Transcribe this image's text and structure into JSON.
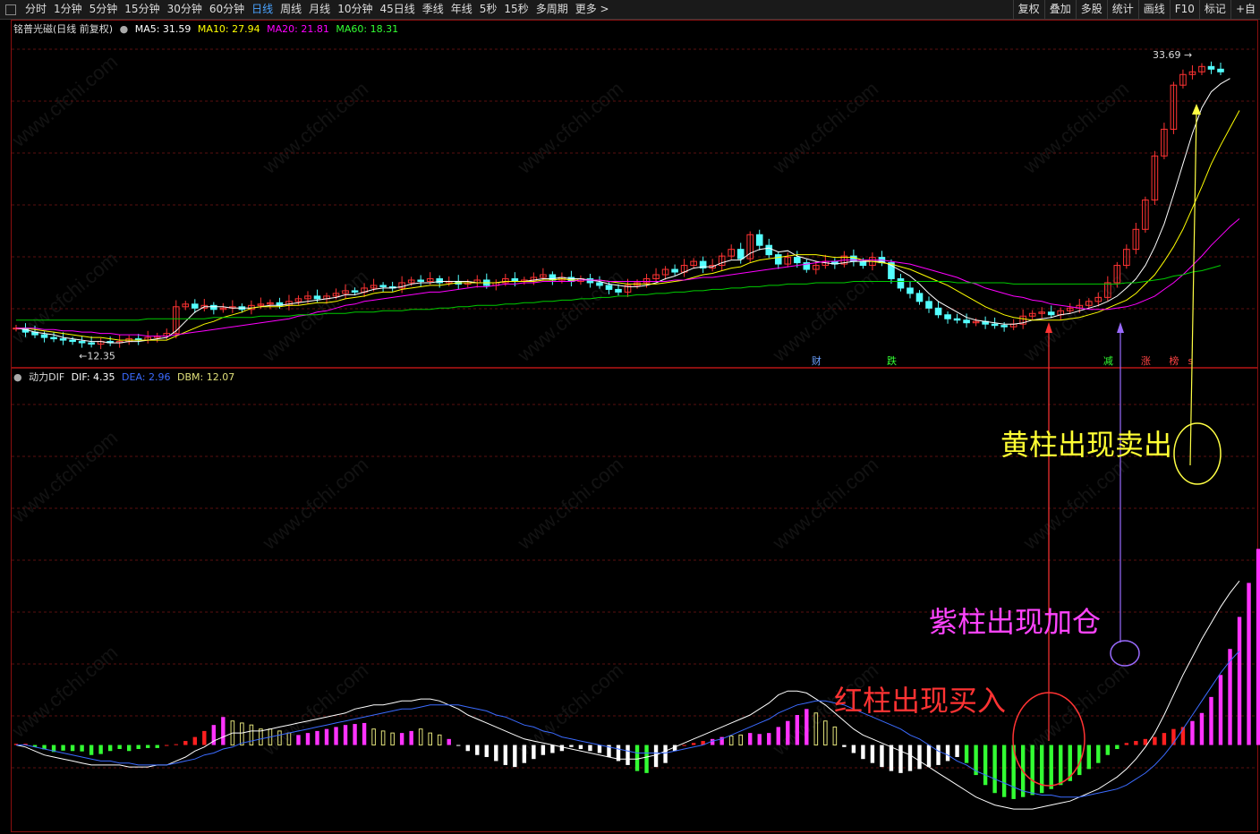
{
  "toolbar": {
    "periods": [
      "分时",
      "1分钟",
      "5分钟",
      "15分钟",
      "30分钟",
      "60分钟",
      "日线",
      "周线",
      "月线",
      "10分钟",
      "45日线",
      "季线",
      "年线",
      "5秒",
      "15秒",
      "多周期",
      "更多 >"
    ],
    "active_period": "日线",
    "tools": [
      "复权",
      "叠加",
      "多股",
      "统计",
      "画线",
      "F10",
      "标记",
      "+自"
    ]
  },
  "watermark": "www.cfchi.com",
  "colors": {
    "ma5": "#ffffff",
    "ma10": "#ffff00",
    "ma20": "#ff00ff",
    "ma60": "#00cc00",
    "up": "#ff3333",
    "down": "#54ffff",
    "dea": "#3b6bff",
    "bar_red": "#ff2020",
    "bar_magenta": "#ff33ff",
    "bar_yellow": "#e0e07a",
    "bar_green": "#33ff33",
    "bar_white": "#ffffff"
  },
  "chart_data": [
    {
      "type": "candlestick",
      "title": "铭普光磁(日线 前复权)",
      "legend": [
        {
          "label": "MA5: 31.59",
          "color": "#ffffff"
        },
        {
          "label": "MA10: 27.94",
          "color": "#ffff00"
        },
        {
          "label": "MA20: 21.81",
          "color": "#ff00ff"
        },
        {
          "label": "MA60: 18.31",
          "color": "#00cc00"
        }
      ],
      "ylim": [
        11.5,
        35.5
      ],
      "annotations": {
        "high": "33.69",
        "low": "12.35"
      },
      "signals": [
        {
          "text": "财",
          "index": 85,
          "color": "#6aa0ff"
        },
        {
          "text": "跌",
          "index": 93,
          "color": "#33ff33"
        },
        {
          "text": "减",
          "index": 116,
          "color": "#33ff33"
        },
        {
          "text": "涨",
          "index": 120,
          "color": "#ff4444"
        },
        {
          "text": "榜",
          "index": 123,
          "color": "#ff4444"
        },
        {
          "text": "s",
          "index": 125,
          "color": "#ff4444"
        }
      ],
      "closes": [
        13.6,
        13.3,
        13.1,
        12.9,
        12.8,
        12.7,
        12.6,
        12.5,
        12.4,
        12.6,
        12.5,
        12.6,
        12.8,
        12.7,
        12.9,
        13.0,
        13.2,
        15.2,
        15.4,
        15.1,
        15.3,
        15.0,
        15.1,
        15.2,
        15.0,
        15.3,
        15.4,
        15.5,
        15.3,
        15.6,
        15.8,
        16.0,
        15.8,
        16.0,
        16.2,
        16.4,
        16.3,
        16.6,
        16.8,
        16.7,
        16.6,
        17.0,
        17.2,
        17.1,
        17.3,
        17.0,
        17.1,
        16.9,
        17.0,
        17.2,
        16.8,
        17.0,
        17.3,
        17.1,
        17.2,
        17.4,
        17.6,
        17.2,
        17.4,
        17.1,
        17.3,
        17.0,
        16.8,
        16.5,
        16.3,
        16.8,
        17.0,
        17.3,
        17.6,
        18.0,
        17.8,
        18.3,
        18.6,
        18.1,
        18.3,
        19.0,
        19.5,
        18.8,
        20.6,
        19.8,
        19.1,
        18.4,
        18.9,
        18.5,
        18.0,
        18.3,
        18.6,
        18.4,
        19.0,
        18.6,
        18.3,
        18.9,
        18.5,
        17.3,
        16.6,
        16.2,
        15.6,
        15.1,
        14.6,
        14.3,
        14.2,
        14.0,
        14.1,
        13.9,
        13.8,
        13.7,
        13.9,
        14.5,
        14.7,
        14.8,
        14.6,
        14.9,
        15.1,
        15.3,
        15.6,
        15.9,
        17.0,
        18.3,
        19.5,
        21.0,
        23.2,
        26.5,
        28.5,
        31.8,
        32.6,
        32.8,
        33.2,
        33.0,
        32.8
      ],
      "ma_series": {
        "MA5": [
          13.6,
          13.5,
          13.3,
          13.2,
          13.1,
          12.9,
          12.8,
          12.7,
          12.6,
          12.6,
          12.5,
          12.5,
          12.6,
          12.6,
          12.7,
          12.8,
          12.9,
          13.4,
          14.1,
          14.8,
          15.2,
          15.2,
          15.2,
          15.1,
          15.1,
          15.1,
          15.2,
          15.3,
          15.3,
          15.4,
          15.5,
          15.6,
          15.7,
          15.8,
          15.9,
          16.1,
          16.1,
          16.3,
          16.5,
          16.6,
          16.6,
          16.7,
          16.9,
          17.0,
          17.0,
          17.1,
          17.1,
          17.1,
          17.1,
          17.0,
          17.0,
          17.0,
          17.1,
          17.1,
          17.1,
          17.2,
          17.3,
          17.3,
          17.4,
          17.3,
          17.3,
          17.2,
          17.1,
          16.9,
          16.8,
          16.7,
          16.7,
          16.8,
          17.0,
          17.3,
          17.5,
          17.8,
          18.1,
          18.2,
          18.2,
          18.5,
          18.7,
          18.7,
          19.2,
          19.5,
          19.6,
          19.3,
          19.4,
          19.0,
          18.8,
          18.6,
          18.5,
          18.4,
          18.5,
          18.6,
          18.6,
          18.6,
          18.6,
          18.3,
          17.9,
          17.5,
          16.9,
          16.2,
          15.6,
          15.2,
          14.8,
          14.4,
          14.2,
          14.1,
          14.0,
          13.9,
          13.9,
          14.0,
          14.2,
          14.3,
          14.4,
          14.6,
          14.7,
          14.9,
          15.1,
          15.3,
          15.6,
          16.0,
          16.6,
          17.3,
          18.3,
          19.7,
          21.4,
          23.6,
          25.9,
          28.2,
          30.1,
          31.3,
          31.9,
          32.3
        ],
        "MA10": [
          13.6,
          13.6,
          13.5,
          13.4,
          13.3,
          13.2,
          13.1,
          13.0,
          12.9,
          12.9,
          12.8,
          12.7,
          12.7,
          12.7,
          12.7,
          12.7,
          12.7,
          13.0,
          13.3,
          13.6,
          13.9,
          14.1,
          14.4,
          14.6,
          14.8,
          15.1,
          15.2,
          15.2,
          15.2,
          15.3,
          15.3,
          15.4,
          15.5,
          15.5,
          15.6,
          15.8,
          15.9,
          16.0,
          16.2,
          16.3,
          16.3,
          16.5,
          16.6,
          16.7,
          16.8,
          16.8,
          16.9,
          17.0,
          17.0,
          17.0,
          17.0,
          17.0,
          17.1,
          17.1,
          17.1,
          17.1,
          17.2,
          17.2,
          17.3,
          17.2,
          17.2,
          17.2,
          17.2,
          17.1,
          17.0,
          16.9,
          16.9,
          16.9,
          16.9,
          17.0,
          17.1,
          17.2,
          17.4,
          17.6,
          17.7,
          17.9,
          18.1,
          18.2,
          18.5,
          18.7,
          18.8,
          18.9,
          19.0,
          19.1,
          19.1,
          19.1,
          19.0,
          18.9,
          18.9,
          18.9,
          18.7,
          18.6,
          18.5,
          18.4,
          18.2,
          18.0,
          17.7,
          17.4,
          17.1,
          16.8,
          16.4,
          16.0,
          15.6,
          15.2,
          14.9,
          14.6,
          14.4,
          14.3,
          14.2,
          14.2,
          14.2,
          14.2,
          14.3,
          14.4,
          14.6,
          14.8,
          15.1,
          15.4,
          15.7,
          16.2,
          16.9,
          17.6,
          18.6,
          19.7,
          21.0,
          22.6,
          24.2,
          25.9,
          27.3,
          28.6,
          29.9
        ],
        "MA20": [
          13.6,
          13.6,
          13.6,
          13.5,
          13.5,
          13.4,
          13.4,
          13.3,
          13.3,
          13.2,
          13.2,
          13.1,
          13.1,
          13.1,
          13.0,
          13.0,
          13.0,
          13.1,
          13.2,
          13.3,
          13.4,
          13.5,
          13.6,
          13.7,
          13.8,
          13.9,
          14.0,
          14.1,
          14.2,
          14.3,
          14.5,
          14.6,
          14.8,
          14.9,
          15.1,
          15.3,
          15.4,
          15.6,
          15.7,
          15.8,
          15.9,
          16.0,
          16.1,
          16.2,
          16.3,
          16.3,
          16.4,
          16.5,
          16.6,
          16.7,
          16.7,
          16.8,
          16.9,
          16.9,
          17.0,
          17.0,
          17.1,
          17.1,
          17.1,
          17.1,
          17.2,
          17.2,
          17.2,
          17.1,
          17.1,
          17.1,
          17.1,
          17.1,
          17.1,
          17.1,
          17.2,
          17.2,
          17.3,
          17.4,
          17.4,
          17.5,
          17.6,
          17.7,
          17.8,
          17.9,
          18.0,
          18.1,
          18.2,
          18.3,
          18.4,
          18.5,
          18.6,
          18.6,
          18.7,
          18.7,
          18.7,
          18.7,
          18.7,
          18.6,
          18.5,
          18.4,
          18.2,
          18.0,
          17.8,
          17.6,
          17.4,
          17.1,
          16.9,
          16.6,
          16.4,
          16.2,
          16.0,
          15.9,
          15.7,
          15.6,
          15.4,
          15.3,
          15.2,
          15.1,
          15.0,
          15.0,
          15.0,
          15.1,
          15.2,
          15.4,
          15.7,
          16.0,
          16.5,
          17.0,
          17.6,
          18.3,
          19.0,
          19.8,
          20.5,
          21.2,
          21.8
        ],
        "MA60": [
          14.2,
          14.2,
          14.2,
          14.2,
          14.2,
          14.2,
          14.2,
          14.2,
          14.2,
          14.2,
          14.2,
          14.2,
          14.2,
          14.2,
          14.3,
          14.3,
          14.3,
          14.3,
          14.3,
          14.3,
          14.3,
          14.4,
          14.4,
          14.4,
          14.4,
          14.4,
          14.5,
          14.5,
          14.5,
          14.5,
          14.6,
          14.6,
          14.6,
          14.7,
          14.7,
          14.7,
          14.8,
          14.8,
          14.8,
          14.9,
          14.9,
          14.9,
          15.0,
          15.0,
          15.0,
          15.1,
          15.1,
          15.2,
          15.2,
          15.3,
          15.3,
          15.3,
          15.4,
          15.4,
          15.5,
          15.5,
          15.6,
          15.6,
          15.7,
          15.7,
          15.8,
          15.8,
          15.9,
          15.9,
          16.0,
          16.0,
          16.1,
          16.1,
          16.2,
          16.2,
          16.3,
          16.3,
          16.4,
          16.4,
          16.5,
          16.5,
          16.6,
          16.6,
          16.7,
          16.7,
          16.8,
          16.8,
          16.9,
          16.9,
          16.9,
          17.0,
          17.0,
          17.0,
          17.0,
          17.1,
          17.1,
          17.1,
          17.1,
          17.1,
          17.1,
          17.1,
          17.1,
          17.1,
          17.1,
          17.1,
          17.0,
          17.0,
          17.0,
          17.0,
          17.0,
          17.0,
          16.9,
          16.9,
          16.9,
          16.9,
          16.9,
          16.9,
          16.9,
          16.9,
          16.9,
          16.9,
          16.9,
          16.9,
          17.0,
          17.0,
          17.1,
          17.2,
          17.3,
          17.5,
          17.6,
          17.8,
          17.9,
          18.1,
          18.3
        ]
      }
    },
    {
      "type": "histogram",
      "title": "动力DIF",
      "legend": [
        {
          "label": "DIF: 4.35",
          "color": "#ffffff"
        },
        {
          "label": "DEA: 2.96",
          "color": "#3b6bff"
        },
        {
          "label": "DBM: 12.07",
          "color": "#e0e07a"
        }
      ],
      "ylim": [
        -4,
        18
      ],
      "bars": [
        0.06,
        0.06,
        -0.1,
        -0.22,
        -0.35,
        -0.28,
        -0.3,
        -0.32,
        -0.5,
        -0.45,
        -0.3,
        -0.2,
        -0.3,
        -0.2,
        -0.15,
        -0.15,
        0.0,
        0.04,
        0.2,
        0.4,
        0.7,
        1.0,
        1.4,
        1.2,
        1.1,
        1.0,
        0.8,
        0.8,
        0.7,
        0.6,
        0.5,
        0.6,
        0.7,
        0.8,
        0.9,
        1.0,
        1.05,
        1.1,
        0.8,
        0.7,
        0.6,
        0.6,
        0.7,
        0.8,
        0.6,
        0.5,
        0.3,
        0.0,
        -0.3,
        -0.5,
        -0.6,
        -0.8,
        -1.0,
        -1.1,
        -0.9,
        -0.7,
        -0.5,
        -0.4,
        -0.3,
        -0.1,
        -0.2,
        -0.3,
        -0.4,
        -0.6,
        -0.8,
        -1.0,
        -1.3,
        -1.4,
        -1.1,
        -0.9,
        -0.3,
        0.0,
        0.1,
        0.2,
        0.3,
        0.4,
        0.45,
        0.5,
        0.6,
        0.55,
        0.6,
        0.9,
        1.2,
        1.5,
        1.8,
        1.6,
        1.2,
        0.9,
        -0.1,
        -0.4,
        -0.7,
        -0.9,
        -1.1,
        -1.3,
        -1.4,
        -1.3,
        -1.2,
        -1.1,
        -1.0,
        -0.8,
        -0.6,
        -0.9,
        -1.5,
        -2.0,
        -2.4,
        -2.6,
        -2.7,
        -2.6,
        -2.5,
        -2.4,
        -2.2,
        -2.0,
        -1.8,
        -1.5,
        -1.2,
        -0.9,
        -0.5,
        -0.2,
        0.1,
        0.2,
        0.3,
        0.4,
        0.6,
        0.8,
        0.9,
        1.2,
        1.6,
        2.4,
        3.5,
        4.8,
        6.4,
        8.1,
        9.8,
        11.2,
        12.07
      ],
      "bar_colors": [
        "r",
        "r",
        "g",
        "g",
        "g",
        "g",
        "g",
        "g",
        "g",
        "g",
        "g",
        "g",
        "g",
        "g",
        "g",
        "g",
        "r",
        "r",
        "r",
        "r",
        "r",
        "m",
        "m",
        "y",
        "y",
        "y",
        "y",
        "y",
        "y",
        "y",
        "m",
        "m",
        "m",
        "m",
        "m",
        "m",
        "m",
        "m",
        "y",
        "y",
        "y",
        "m",
        "m",
        "y",
        "y",
        "y",
        "m",
        "w",
        "w",
        "w",
        "w",
        "w",
        "w",
        "w",
        "w",
        "w",
        "w",
        "w",
        "w",
        "w",
        "w",
        "w",
        "w",
        "w",
        "w",
        "w",
        "g",
        "g",
        "w",
        "w",
        "w",
        "r",
        "r",
        "r",
        "m",
        "m",
        "y",
        "y",
        "m",
        "m",
        "m",
        "m",
        "m",
        "m",
        "m",
        "y",
        "y",
        "y",
        "w",
        "w",
        "w",
        "w",
        "w",
        "w",
        "w",
        "w",
        "w",
        "w",
        "w",
        "w",
        "w",
        "g",
        "g",
        "g",
        "g",
        "g",
        "g",
        "g",
        "g",
        "g",
        "g",
        "g",
        "g",
        "g",
        "g",
        "g",
        "g",
        "g",
        "r",
        "r",
        "r",
        "r",
        "r",
        "r",
        "r",
        "m",
        "m",
        "m",
        "m",
        "m",
        "m",
        "m",
        "m",
        "y",
        "y",
        "y"
      ],
      "dif": [
        0.0,
        -0.1,
        -0.3,
        -0.5,
        -0.6,
        -0.7,
        -0.8,
        -0.9,
        -1.0,
        -1.0,
        -1.0,
        -1.0,
        -1.1,
        -1.1,
        -1.1,
        -1.0,
        -1.0,
        -0.8,
        -0.6,
        -0.3,
        -0.1,
        0.2,
        0.4,
        0.6,
        0.6,
        0.7,
        0.7,
        0.8,
        0.9,
        1.0,
        1.1,
        1.2,
        1.3,
        1.4,
        1.5,
        1.6,
        1.8,
        1.9,
        2.0,
        2.0,
        2.1,
        2.2,
        2.2,
        2.3,
        2.3,
        2.2,
        2.0,
        1.8,
        1.5,
        1.3,
        1.1,
        0.9,
        0.7,
        0.5,
        0.3,
        0.2,
        0.1,
        0.0,
        -0.1,
        -0.2,
        -0.3,
        -0.4,
        -0.5,
        -0.6,
        -0.7,
        -0.7,
        -0.7,
        -0.6,
        -0.5,
        -0.3,
        -0.1,
        0.1,
        0.3,
        0.5,
        0.7,
        0.9,
        1.1,
        1.3,
        1.5,
        1.8,
        2.1,
        2.5,
        2.7,
        2.7,
        2.6,
        2.3,
        2.0,
        1.6,
        1.2,
        0.8,
        0.5,
        0.3,
        0.1,
        -0.1,
        -0.3,
        -0.5,
        -0.8,
        -1.1,
        -1.4,
        -1.7,
        -2.0,
        -2.3,
        -2.6,
        -2.8,
        -3.0,
        -3.1,
        -3.2,
        -3.2,
        -3.2,
        -3.1,
        -3.0,
        -2.9,
        -2.8,
        -2.6,
        -2.4,
        -2.2,
        -1.9,
        -1.6,
        -1.2,
        -0.7,
        -0.1,
        0.6,
        1.5,
        2.5,
        3.5,
        4.4,
        5.3,
        6.1,
        6.9,
        7.6,
        8.2
      ],
      "dea": [
        0.0,
        0.0,
        -0.1,
        -0.2,
        -0.3,
        -0.4,
        -0.5,
        -0.6,
        -0.7,
        -0.8,
        -0.8,
        -0.9,
        -0.9,
        -1.0,
        -1.0,
        -1.0,
        -1.0,
        -0.9,
        -0.8,
        -0.7,
        -0.5,
        -0.4,
        -0.2,
        -0.1,
        0.1,
        0.2,
        0.3,
        0.4,
        0.5,
        0.6,
        0.7,
        0.8,
        0.9,
        1.0,
        1.1,
        1.2,
        1.3,
        1.4,
        1.5,
        1.6,
        1.7,
        1.8,
        1.8,
        1.9,
        2.0,
        2.0,
        2.0,
        2.0,
        1.9,
        1.8,
        1.7,
        1.5,
        1.4,
        1.2,
        1.0,
        0.9,
        0.7,
        0.6,
        0.4,
        0.3,
        0.2,
        0.1,
        0.0,
        -0.1,
        -0.2,
        -0.3,
        -0.4,
        -0.4,
        -0.4,
        -0.4,
        -0.3,
        -0.2,
        -0.1,
        0.0,
        0.2,
        0.3,
        0.5,
        0.7,
        0.9,
        1.1,
        1.3,
        1.6,
        1.8,
        2.0,
        2.1,
        2.2,
        2.2,
        2.1,
        2.0,
        1.8,
        1.6,
        1.4,
        1.2,
        1.0,
        0.8,
        0.5,
        0.3,
        0.0,
        -0.3,
        -0.5,
        -0.8,
        -1.0,
        -1.3,
        -1.5,
        -1.7,
        -1.9,
        -2.1,
        -2.3,
        -2.4,
        -2.5,
        -2.5,
        -2.6,
        -2.6,
        -2.6,
        -2.5,
        -2.4,
        -2.3,
        -2.2,
        -2.0,
        -1.7,
        -1.4,
        -1.0,
        -0.5,
        0.1,
        0.8,
        1.5,
        2.2,
        2.9,
        3.6,
        4.2,
        4.7
      ]
    }
  ],
  "annotations_cn": {
    "sell": "黄柱出现卖出",
    "add": "紫柱出现加仓",
    "buy": "红柱出现买入"
  }
}
